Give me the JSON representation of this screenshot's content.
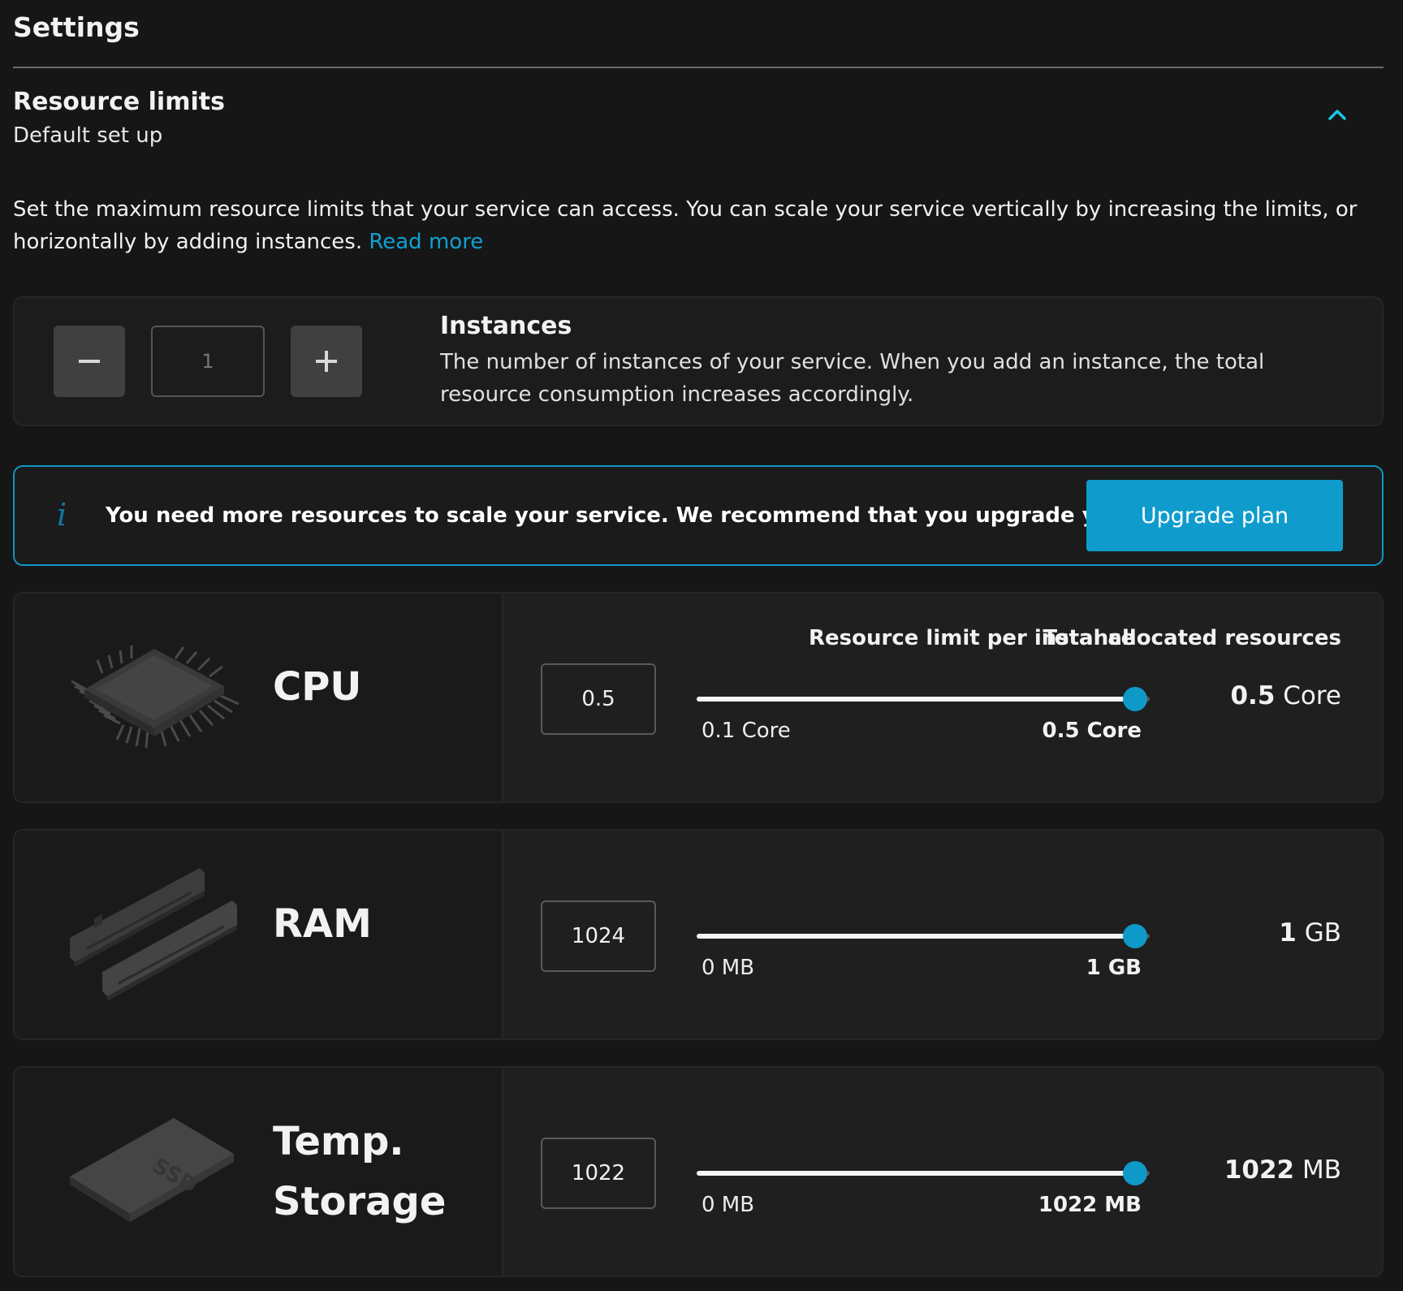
{
  "page": {
    "title": "Settings"
  },
  "section": {
    "title": "Resource limits",
    "subtitle": "Default set up",
    "description": "Set the maximum resource limits that your service can access. You can scale your service vertically by increasing the limits, or horizontally by adding instances.",
    "read_more": "Read more"
  },
  "instances": {
    "title": "Instances",
    "description": "The number of instances of your service. When you add an instance, the total resource consumption increases accordingly.",
    "value": "1",
    "minus_icon": "minus-icon",
    "plus_icon": "plus-icon"
  },
  "alert": {
    "icon": "info-icon",
    "text": "You need more resources to scale your service. We recommend that you upgrade your plan.",
    "button": "Upgrade plan"
  },
  "headers": {
    "per_instance": "Resource limit per instance",
    "total": "Total allocated resources"
  },
  "resources": [
    {
      "name": "CPU",
      "icon": "cpu-chip-icon",
      "input_value": "0.5",
      "min_label": "0.1 Core",
      "max_label": "0.5 Core",
      "slider_level": 1.0,
      "total_value": "0.5",
      "total_unit": "Core"
    },
    {
      "name": "RAM",
      "icon": "ram-module-icon",
      "input_value": "1024",
      "min_label": "0 MB",
      "max_label": "1 GB",
      "slider_level": 1.0,
      "total_value": "1",
      "total_unit": "GB"
    },
    {
      "name_line1": "Temp.",
      "name_line2": "Storage",
      "icon": "ssd-drive-icon",
      "icon_label": "SSD",
      "input_value": "1022",
      "min_label": "0 MB",
      "max_label": "1022 MB",
      "slider_level": 1.0,
      "total_value": "1022",
      "total_unit": "MB"
    }
  ],
  "colors": {
    "background": "#161616",
    "accent": "#0f9ccd",
    "link": "#0fa1d1"
  }
}
